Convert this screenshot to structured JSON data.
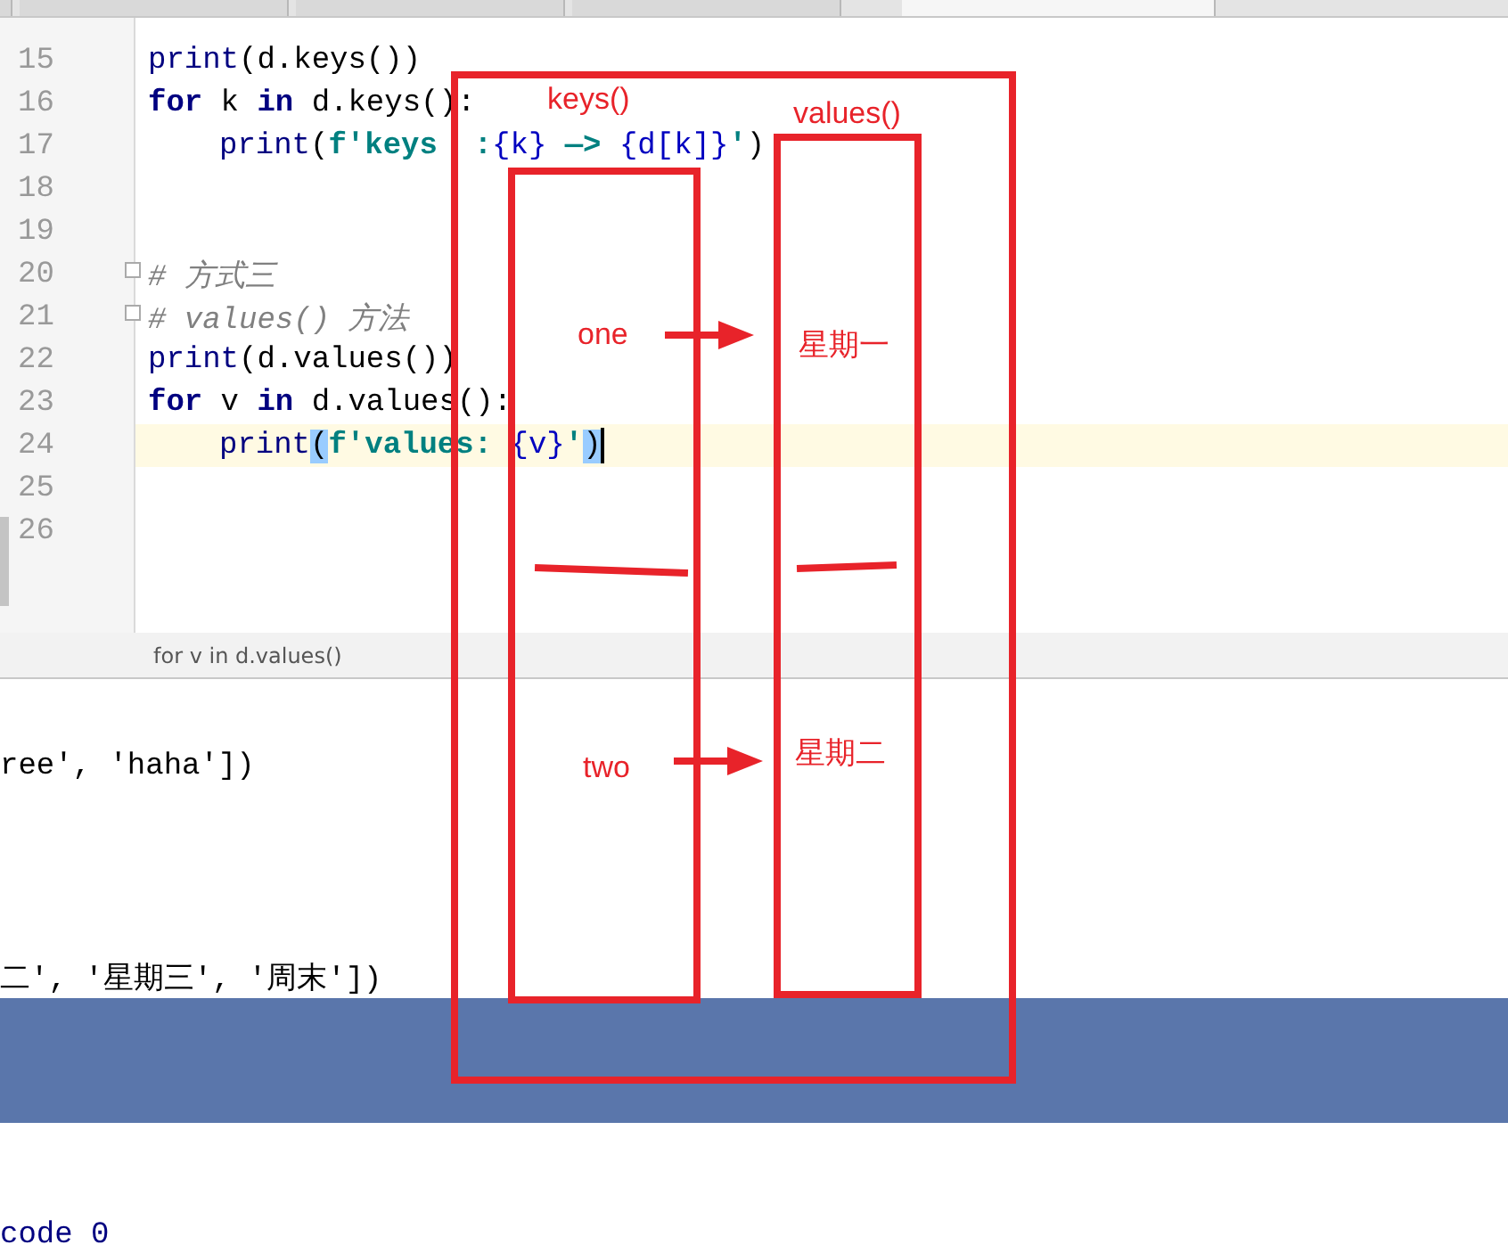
{
  "tabs": [
    {
      "selected": false
    },
    {
      "selected": false
    },
    {
      "selected": false
    },
    {
      "selected": false
    },
    {
      "selected": true
    }
  ],
  "editor": {
    "lines": [
      {
        "number": "15",
        "current": false,
        "fold": false,
        "indent": false,
        "tokens": [
          {
            "text": "print",
            "kind": "builtin"
          },
          {
            "text": "(d.keys())",
            "kind": "plain"
          }
        ]
      },
      {
        "number": "16",
        "current": false,
        "fold": false,
        "indent": false,
        "tokens": [
          {
            "text": "for",
            "kind": "keyword"
          },
          {
            "text": " k ",
            "kind": "plain"
          },
          {
            "text": "in",
            "kind": "keyword"
          },
          {
            "text": " d.keys():",
            "kind": "plain"
          }
        ]
      },
      {
        "number": "17",
        "current": false,
        "fold": false,
        "indent": true,
        "tokens": [
          {
            "text": "print",
            "kind": "builtin"
          },
          {
            "text": "(",
            "kind": "plain"
          },
          {
            "text": "f'keys  :",
            "kind": "string"
          },
          {
            "text": "{k}",
            "kind": "brace"
          },
          {
            "text": " —> ",
            "kind": "string"
          },
          {
            "text": "{d[k]}",
            "kind": "brace"
          },
          {
            "text": "'",
            "kind": "string"
          },
          {
            "text": ")",
            "kind": "plain"
          }
        ]
      },
      {
        "number": "18",
        "current": false,
        "fold": false
      },
      {
        "number": "19",
        "current": false,
        "fold": false
      },
      {
        "number": "20",
        "current": false,
        "fold": true,
        "indent": false,
        "tokens": [
          {
            "text": "# 方式三",
            "kind": "comment"
          }
        ]
      },
      {
        "number": "21",
        "current": false,
        "fold": true,
        "indent": false,
        "tokens": [
          {
            "text": "# values() 方法",
            "kind": "comment"
          }
        ]
      },
      {
        "number": "22",
        "current": false,
        "fold": false,
        "indent": false,
        "tokens": [
          {
            "text": "print",
            "kind": "builtin"
          },
          {
            "text": "(d.values())",
            "kind": "plain"
          }
        ]
      },
      {
        "number": "23",
        "current": false,
        "fold": false,
        "indent": false,
        "tokens": [
          {
            "text": "for",
            "kind": "keyword"
          },
          {
            "text": " v ",
            "kind": "plain"
          },
          {
            "text": "in",
            "kind": "keyword"
          },
          {
            "text": " d.values():",
            "kind": "plain"
          }
        ]
      },
      {
        "number": "24",
        "current": true,
        "fold": false,
        "indent": true,
        "tokens": [
          {
            "text": "print",
            "kind": "builtin"
          },
          {
            "text": "(",
            "kind": "match"
          },
          {
            "text": "f'values: ",
            "kind": "string"
          },
          {
            "text": "{v}",
            "kind": "brace"
          },
          {
            "text": "'",
            "kind": "string"
          },
          {
            "text": ")",
            "kind": "match"
          }
        ]
      },
      {
        "number": "25",
        "current": false,
        "fold": false
      },
      {
        "number": "26",
        "current": false,
        "fold": false
      }
    ]
  },
  "breadcrumb": "for v in d.values()",
  "console": {
    "lines": [
      "ree', 'haha'])",
      "二', '星期三', '周末'])"
    ],
    "exit": "code 0"
  },
  "annotations": {
    "keys_label": "keys()",
    "values_label": "values()",
    "arrows": [
      {
        "key": "one",
        "value": "星期一"
      },
      {
        "key": "two",
        "value": "星期二"
      }
    ]
  }
}
